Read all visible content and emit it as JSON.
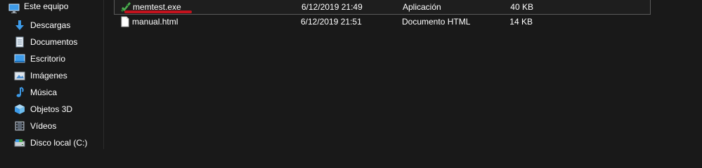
{
  "sidebar": {
    "root": {
      "label": "Este equipo",
      "icon": "computer-icon"
    },
    "items": [
      {
        "label": "Descargas",
        "icon": "download-arrow-icon"
      },
      {
        "label": "Documentos",
        "icon": "documents-icon"
      },
      {
        "label": "Escritorio",
        "icon": "desktop-icon"
      },
      {
        "label": "Imágenes",
        "icon": "pictures-icon"
      },
      {
        "label": "Música",
        "icon": "music-note-icon"
      },
      {
        "label": "Objetos 3D",
        "icon": "cube-3d-icon"
      },
      {
        "label": "Vídeos",
        "icon": "videos-icon"
      },
      {
        "label": "Disco local (C:)",
        "icon": "drive-icon"
      }
    ]
  },
  "files": [
    {
      "name": "memtest.exe",
      "date": "6/12/2019 21:49",
      "type": "Aplicación",
      "size": "40 KB",
      "icon": "memtest-app-icon",
      "selected": true
    },
    {
      "name": "manual.html",
      "date": "6/12/2019 21:51",
      "type": "Documento HTML",
      "size": "14 KB",
      "icon": "html-file-icon",
      "selected": false
    }
  ],
  "colors": {
    "background": "#191919",
    "text": "#ffffff",
    "annotation_underline": "#c4121d",
    "folder_blue": "#3d9be9"
  }
}
